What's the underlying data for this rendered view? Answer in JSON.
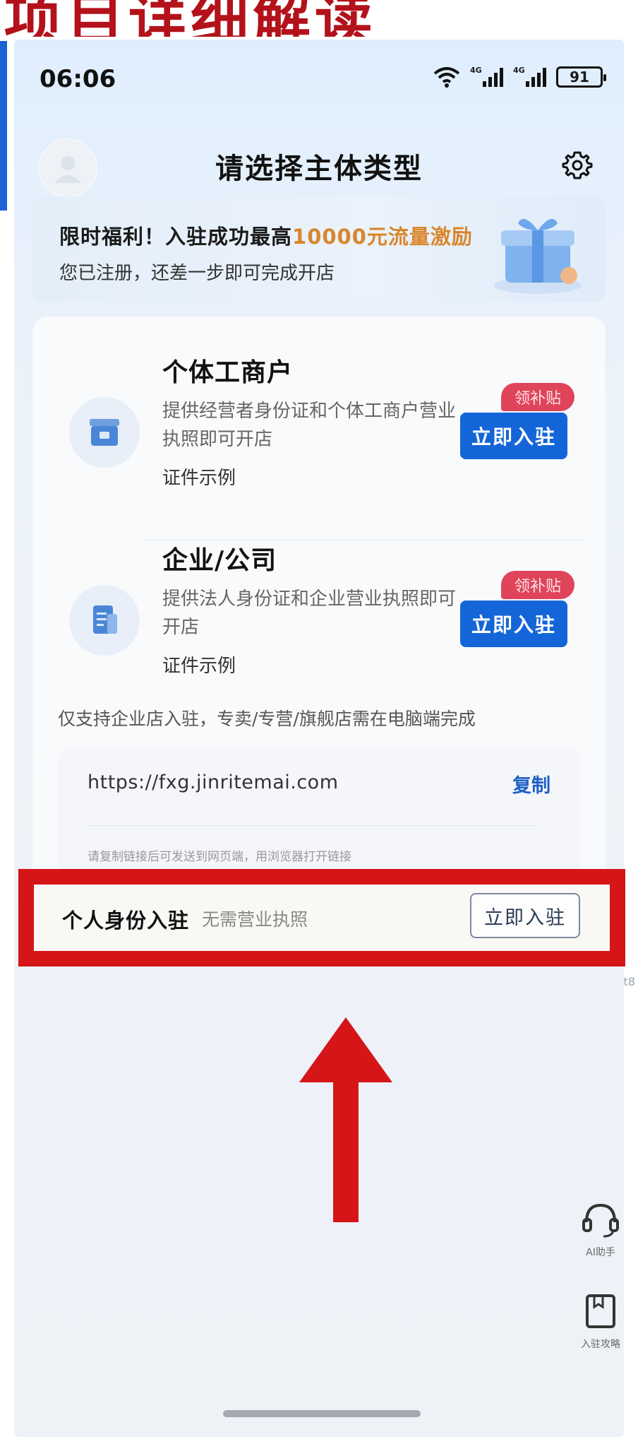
{
  "banner": {
    "caption": "项目详细解读"
  },
  "status_bar": {
    "time": "06:06",
    "network_tag": "4G",
    "battery": "91"
  },
  "header": {
    "title": "请选择主体类型"
  },
  "promo": {
    "title_prefix": "限时福利！入驻成功最高",
    "title_highlight": "10000元流量激励",
    "subtitle": "您已注册，还差一步即可完成开店"
  },
  "entity_types": [
    {
      "title": "个体工商户",
      "description": "提供经营者身份证和个体工商户营业执照即可开店",
      "example_link": "证件示例",
      "badge": "领补贴",
      "button": "立即入驻"
    },
    {
      "title": "企业/公司",
      "description": "提供法人身份证和企业营业执照即可开店",
      "example_link": "证件示例",
      "badge": "领补贴",
      "button": "立即入驻"
    }
  ],
  "note": "仅支持企业店入驻，专卖/专营/旗舰店需在电脑端完成",
  "url_box": {
    "url": "https://fxg.jinritemai.com",
    "copy": "复制",
    "hint": "请复制链接后可发送到网页端，用浏览器打开链接"
  },
  "personal": {
    "title": "个人身份入驻",
    "subtitle": "无需营业执照",
    "button": "立即入驻"
  },
  "side_tools": {
    "ai_label": "AI助手",
    "guide_label": "入驻攻略"
  },
  "ghost_char": "t8",
  "colors": {
    "accent_blue": "#1466d8",
    "highlight_red": "#d51517",
    "promo_orange": "#d9862b"
  }
}
